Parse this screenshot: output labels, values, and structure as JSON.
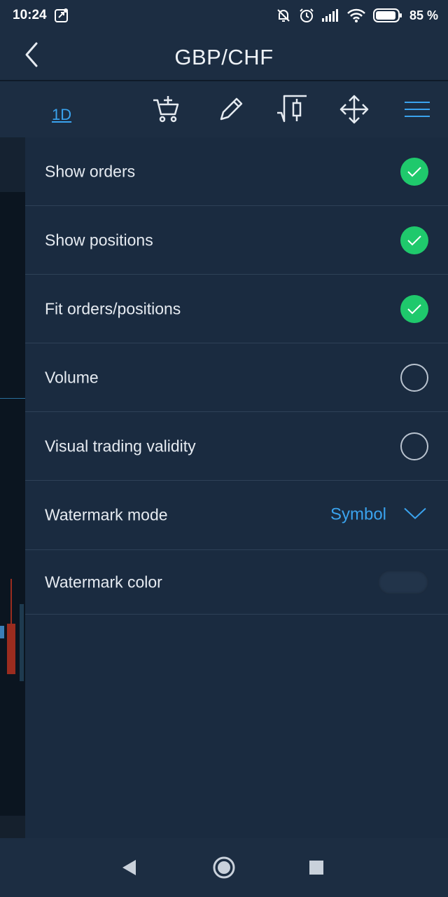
{
  "status_bar": {
    "time": "10:24",
    "battery": "85 %"
  },
  "header": {
    "title": "GBP/CHF"
  },
  "toolbar": {
    "period": "1D",
    "icons": [
      "add-to-cart-icon",
      "pencil-icon",
      "candlestick-icon",
      "move-arrows-icon",
      "menu-icon"
    ]
  },
  "settings": {
    "show_orders": {
      "label": "Show orders",
      "checked": true
    },
    "show_positions": {
      "label": "Show positions",
      "checked": true
    },
    "fit_orders": {
      "label": "Fit orders/positions",
      "checked": true
    },
    "volume": {
      "label": "Volume",
      "checked": false
    },
    "visual_trading": {
      "label": "Visual trading validity",
      "checked": false
    },
    "watermark_mode": {
      "label": "Watermark mode",
      "value": "Symbol"
    },
    "watermark_color": {
      "label": "Watermark color"
    }
  },
  "colors": {
    "accent": "#3aa3ee",
    "check": "#1fc96c",
    "background": "#1a2b40"
  }
}
